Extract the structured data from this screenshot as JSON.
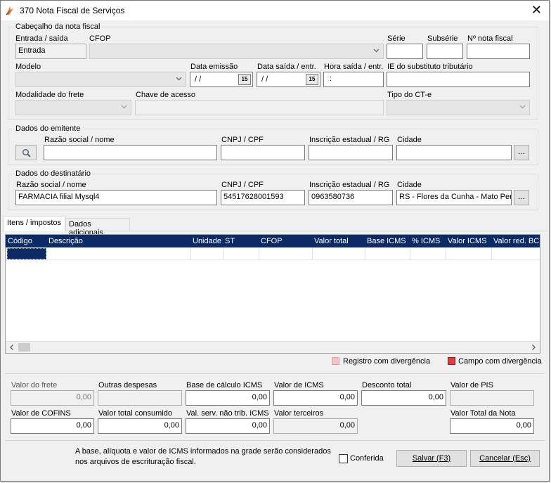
{
  "window": {
    "title": "370 Nota Fiscal de Serviços"
  },
  "cabecalho": {
    "title": "Cabeçalho da nota fiscal",
    "entrada_saida_label": "Entrada / saída",
    "entrada_saida_value": "Entrada",
    "cfop_label": "CFOP",
    "serie_label": "Série",
    "subserie_label": "Subsérie",
    "numero_label": "Nº nota fiscal",
    "modelo_label": "Modelo",
    "data_emissao_label": "Data emissão",
    "data_emissao_value": " / /",
    "data_saida_label": "Data saída / entr.",
    "data_saida_value": " / /",
    "hora_saida_label": "Hora saída / entr.",
    "hora_saida_value": ":",
    "ie_substituto_label": "IE do substituto tributário",
    "modalidade_frete_label": "Modalidade do frete",
    "chave_acesso_label": "Chave de acesso",
    "tipo_cte_label": "Tipo do CT-e",
    "calendar_glyph": "15"
  },
  "emitente": {
    "title": "Dados do emitente",
    "razao_label": "Razão social / nome",
    "cnpj_label": "CNPJ / CPF",
    "ie_label": "Inscrição estadual / RG",
    "cidade_label": "Cidade",
    "browse_label": "..."
  },
  "destinatario": {
    "title": "Dados do destinatário",
    "razao_label": "Razão social / nome",
    "razao_value": "FARMACIA filial Mysql4",
    "cnpj_label": "CNPJ / CPF",
    "cnpj_value": "54517628001593",
    "ie_label": "Inscrição estadual / RG",
    "ie_value": "0963580736",
    "cidade_label": "Cidade",
    "cidade_value": "RS - Flores da Cunha - Mato Pers",
    "browse_label": "..."
  },
  "tabs": [
    {
      "label": "Itens / impostos"
    },
    {
      "label": "Dados adicionais"
    }
  ],
  "grid": {
    "columns": [
      "Código",
      "Descrição",
      "Unidade",
      "ST",
      "CFOP",
      "Valor total",
      "Base ICMS",
      "% ICMS",
      "Valor ICMS",
      "Valor red. BC"
    ]
  },
  "legend": {
    "registro": "Registro com divergência",
    "campo": "Campo com divergência",
    "registro_color": "#f4c2c2",
    "campo_color": "#e03c3c"
  },
  "totais": {
    "valor_frete_label": "Valor do frete",
    "valor_frete_value": "0,00",
    "outras_despesas_label": "Outras despesas",
    "base_calculo_label": "Base de cálculo ICMS",
    "base_calculo_value": "0,00",
    "valor_icms_label": "Valor de ICMS",
    "valor_icms_value": "0,00",
    "desconto_label": "Desconto total",
    "desconto_value": "0,00",
    "valor_pis_label": "Valor de PIS",
    "valor_cofins_label": "Valor de COFINS",
    "valor_cofins_value": "0,00",
    "total_consumido_label": "Valor total consumido",
    "total_consumido_value": "0,00",
    "val_serv_label": "Val. serv. não trib. ICMS",
    "val_serv_value": "0,00",
    "valor_terceiros_label": "Valor terceiros",
    "valor_terceiros_value": "0,00",
    "valor_total_nota_label": "Valor Total da Nota",
    "valor_total_nota_value": "0,00"
  },
  "footer": {
    "note_line1": "A base, alíquota e valor de ICMS informados na grade serão considerados",
    "note_line2": "nos arquivos de escrituração fiscal.",
    "conferida_label": "Conferida",
    "salvar_label": "Salvar (F3)",
    "cancelar_label": "Cancelar (Esc)"
  }
}
